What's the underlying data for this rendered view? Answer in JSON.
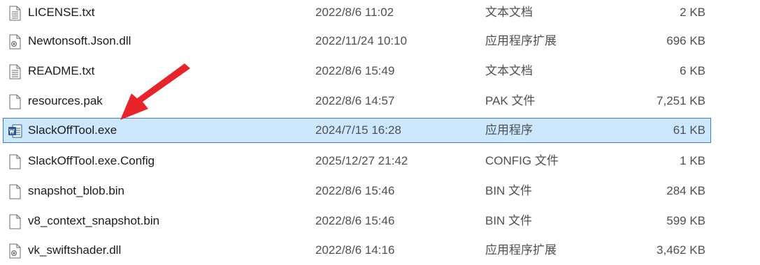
{
  "files": [
    {
      "name": "LICENSE.txt",
      "date": "2022/8/6 11:02",
      "type": "文本文档",
      "size": "2 KB",
      "icon": "text-file-icon"
    },
    {
      "name": "Newtonsoft.Json.dll",
      "date": "2022/11/24 10:10",
      "type": "应用程序扩展",
      "size": "696 KB",
      "icon": "dll-file-icon"
    },
    {
      "name": "README.txt",
      "date": "2022/8/6 15:49",
      "type": "文本文档",
      "size": "6 KB",
      "icon": "text-file-icon"
    },
    {
      "name": "resources.pak",
      "date": "2022/8/6 14:57",
      "type": "PAK 文件",
      "size": "7,251 KB",
      "icon": "blank-file-icon"
    },
    {
      "name": "SlackOffTool.exe",
      "date": "2024/7/15 16:28",
      "type": "应用程序",
      "size": "61 KB",
      "icon": "word-app-icon",
      "selected": true
    },
    {
      "name": "SlackOffTool.exe.Config",
      "date": "2025/12/27 21:42",
      "type": "CONFIG 文件",
      "size": "1 KB",
      "icon": "blank-file-icon"
    },
    {
      "name": "snapshot_blob.bin",
      "date": "2022/8/6 15:46",
      "type": "BIN 文件",
      "size": "284 KB",
      "icon": "blank-file-icon"
    },
    {
      "name": "v8_context_snapshot.bin",
      "date": "2022/8/6 15:46",
      "type": "BIN 文件",
      "size": "599 KB",
      "icon": "blank-file-icon"
    },
    {
      "name": "vk_swiftshader.dll",
      "date": "2022/8/6 14:16",
      "type": "应用程序扩展",
      "size": "3,462 KB",
      "icon": "dll-file-icon"
    }
  ],
  "colors": {
    "selection_background": "#cce8ff",
    "selection_border": "#3a7bd5",
    "annotation_arrow": "#e8232a"
  }
}
